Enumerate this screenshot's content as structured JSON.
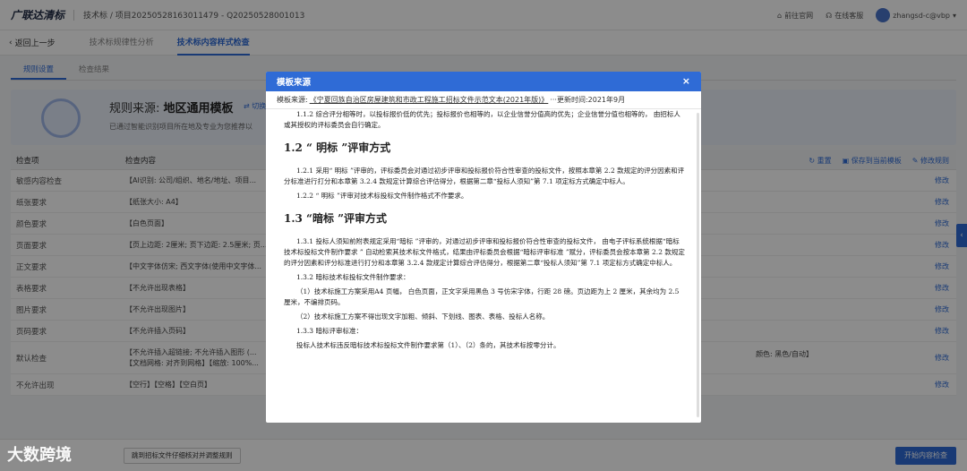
{
  "header": {
    "logo": "广联达清标",
    "breadcrumb": "技术标 / 项目20250528163011479 - Q20250528001013",
    "official_site": "前往官网",
    "online_service": "在线客服",
    "username": "zhangsd-c@vbp"
  },
  "subnav": {
    "back": "返回上一步",
    "tabs": [
      {
        "label": "技术标规律性分析"
      },
      {
        "label": "技术标内容样式检查"
      }
    ]
  },
  "content_tabs": [
    {
      "label": "规则设置"
    },
    {
      "label": "检查结果"
    }
  ],
  "template_card": {
    "title_prefix": "规则来源:",
    "title_value": "地区通用模板",
    "switch": "切换",
    "desc": "已通过智能识别项目所在地及专业为您推荐以"
  },
  "table": {
    "headers": [
      "检查项",
      "检查内容"
    ],
    "actions": [
      "重置",
      "保存到当前模板",
      "修改规则"
    ],
    "edit_label": "修改",
    "rows": [
      {
        "item": "敏感内容检查",
        "content": "【AI识别: 公司/组织、地名/地址、项目..."
      },
      {
        "item": "纸张要求",
        "content": "【纸张大小: A4】"
      },
      {
        "item": "颜色要求",
        "content": "【白色页面】"
      },
      {
        "item": "页面要求",
        "content": "【页上边距: 2厘米; 页下边距: 2.5厘米; 页..."
      },
      {
        "item": "正文要求",
        "content": "【中文字体仿宋; 西文字体(使用中文字体..."
      },
      {
        "item": "表格要求",
        "content": "【不允许出现表格】"
      },
      {
        "item": "图片要求",
        "content": "【不允许出现图片】"
      },
      {
        "item": "页码要求",
        "content": "【不允许插入页码】"
      },
      {
        "item": "默认检查",
        "content": "【不允许插入超链接; 不允许插入图形 (...",
        "content2": "【文档网格: 对齐到网格】【缩放: 100%...",
        "extra": "颜色: 黑色/自动】"
      },
      {
        "item": "不允许出现",
        "content": "【空行】【空格】【空白页】"
      }
    ]
  },
  "footer": {
    "secondary_button": "跳到招标文件仔细核对并调整规则",
    "primary_button": "开始内容检查"
  },
  "watermark": "大数跨境",
  "modal": {
    "title": "模板来源",
    "close": "×",
    "source_label": "模板来源:",
    "source_link": "《宁夏回族自治区房屋建筑和市政工程施工招标文件示范文本(2021年版)》",
    "source_time": "···更新时间:2021年9月",
    "doc": {
      "p0": "1.1.2 综合评分相等时，以投标报价低的优先；投标报价也相等的，以企业信誉分值高的优先；企业信誉分值也相等的， 由招标人或其授权的评标委员会自行确定。",
      "h1": "1.2 “ 明标 ”评审方式",
      "p1": "1.2.1 采用“ 明标 ”评审的，评标委员会对通过初步评审和投标报价符合性审查的投标文件，按照本章第 2.2 款规定的评分因素和评分标准进行打分和本章第 3.2.4 款规定计算综合评估得分，根据第二章“投标人须知”第 7.1 项定标方式确定中标人。",
      "p2": "1.2.2 “ 明标 ”评审对技术标投标文件制作格式不作要求。",
      "h2": "1.3 “暗标 ”评审方式",
      "p3": "1.3.1 投标人须知前附表规定采用“暗标 ”评审的，对通过初步评审和投标报价符合性审查的投标文件， 由电子评标系统根据“暗标技术标投标文件制作要求 ” 自动检索其技术标文件格式，结果由评标委员会根据“暗标评审标准 ”赋分，评标委员会按本章第 2.2 款规定的评分因素和评分标准进行打分和本章第 3.2.4 款规定计算综合评估得分，根据第二章“投标人须知”第 7.1 项定标方式确定中标人。",
      "p4": "1.3.2 暗标技术标投标文件制作要求：",
      "p5": "（1）技术标施工方案采用A4 页幅， 白色页面，正文字采用黑色 3 号仿宋字体，行距 28 磅。页边距为上 2 厘米，其余均为 2.5 厘米，不编排页码。",
      "p6": "（2）技术标施工方案不得出现文字加粗、倾斜、下划线、图表、表格、投标人名称。",
      "p7": "1.3.3 暗标评审标准：",
      "p8": "投标人技术标违反暗标技术标投标文件制作要求第（1）、（2）条的，其技术标按零分计。"
    }
  }
}
